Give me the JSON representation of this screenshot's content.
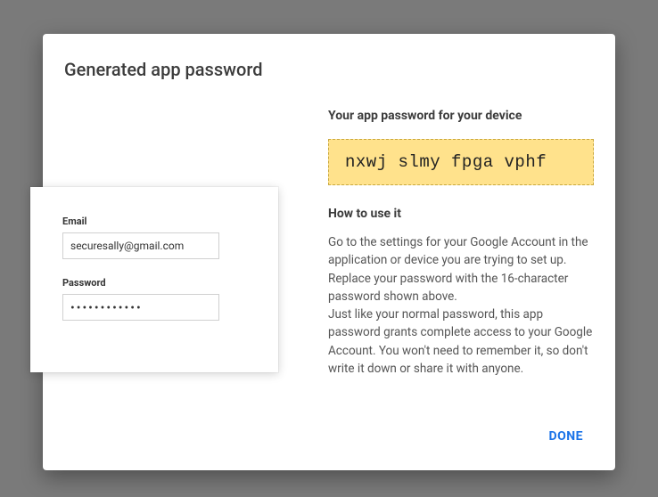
{
  "dialog": {
    "title": "Generated app password"
  },
  "device_preview": {
    "email_label": "Email",
    "email_value": "securesally@gmail.com",
    "password_label": "Password",
    "password_value": "••••••••••••"
  },
  "right": {
    "heading": "Your app password for your device",
    "app_password": "nxwj slmy fpga vphf",
    "howto_heading": "How to use it",
    "howto_p1": "Go to the settings for your Google Account in the application or device you are trying to set up. Replace your password with the 16-character password shown above.",
    "howto_p2": "Just like your normal password, this app password grants complete access to your Google Account. You won't need to remember it, so don't write it down or share it with anyone."
  },
  "footer": {
    "done_label": "DONE"
  }
}
